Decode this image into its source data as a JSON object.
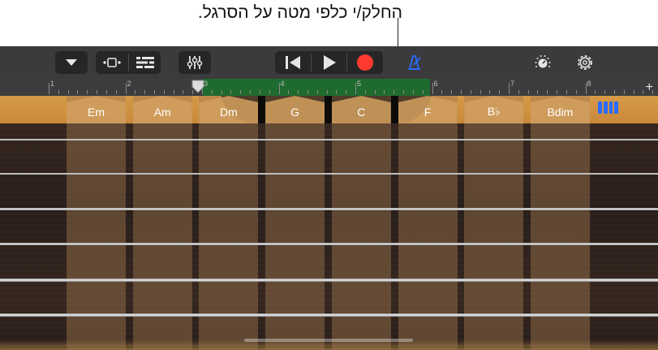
{
  "callout": {
    "text": "החלק/י כלפי מטה על הסרגל."
  },
  "controlbar": {
    "buttons": [
      "browser-dropdown",
      "tracks-view",
      "track-controls",
      "mixer",
      "rewind",
      "play",
      "record",
      "metronome",
      "master-volume",
      "settings"
    ]
  },
  "ruler": {
    "bars": [
      "1",
      "2",
      "3",
      "4",
      "5",
      "6",
      "7",
      "8"
    ],
    "add_label": "+"
  },
  "chords": [
    "Em",
    "Am",
    "Dm",
    "G",
    "C",
    "F",
    "B♭",
    "Bdim"
  ],
  "colors": {
    "record": "#ff3b30",
    "accent": "#2a6cff",
    "region": "#1f6b2f",
    "wood": "#d69a49"
  }
}
